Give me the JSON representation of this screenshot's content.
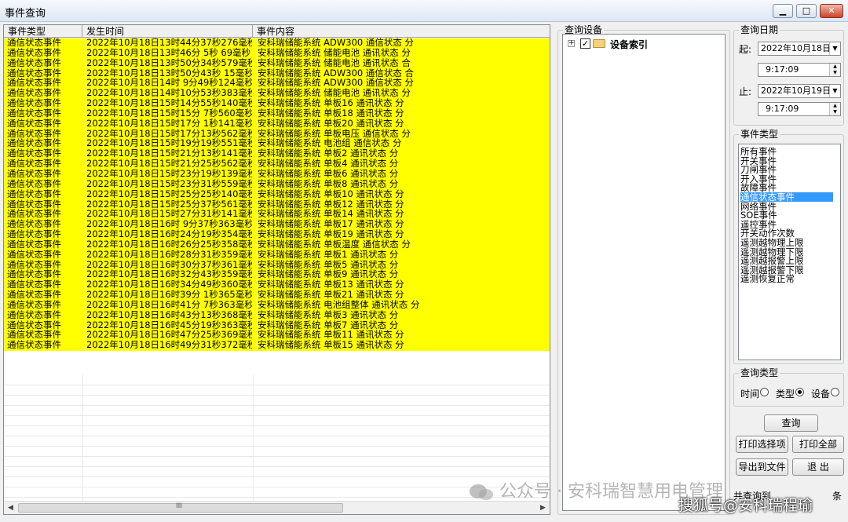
{
  "window": {
    "title": "事件查询",
    "min_glyph": "▁",
    "max_glyph": "□",
    "close_glyph": "✕"
  },
  "grid": {
    "columns": [
      "事件类型",
      "发生时间",
      "事件内容"
    ],
    "rows": [
      [
        "通信状态事件",
        "2022年10月18日13时44分37秒276毫秒",
        "安科瑞储能系统 ADW300 通信状态 分"
      ],
      [
        "通信状态事件",
        "2022年10月18日13时46分 5秒 69毫秒",
        "安科瑞储能系统 储能电池 通讯状态 分"
      ],
      [
        "通信状态事件",
        "2022年10月18日13时50分34秒579毫秒",
        "安科瑞储能系统 储能电池 通讯状态 合"
      ],
      [
        "通信状态事件",
        "2022年10月18日13时50分43秒 15毫秒",
        "安科瑞储能系统 ADW300 通信状态 合"
      ],
      [
        "通信状态事件",
        "2022年10月18日14时 9分49秒124毫秒",
        "安科瑞储能系统 ADW300 通信状态 分"
      ],
      [
        "通信状态事件",
        "2022年10月18日14时10分53秒383毫秒",
        "安科瑞储能系统 储能电池 通讯状态 分"
      ],
      [
        "通信状态事件",
        "2022年10月18日15时14分55秒140毫秒",
        "安科瑞储能系统 单板16 通讯状态 分"
      ],
      [
        "通信状态事件",
        "2022年10月18日15时15分 7秒560毫秒",
        "安科瑞储能系统 单板18 通讯状态 分"
      ],
      [
        "通信状态事件",
        "2022年10月18日15时17分 1秒141毫秒",
        "安科瑞储能系统 单板20 通讯状态 分"
      ],
      [
        "通信状态事件",
        "2022年10月18日15时17分13秒562毫秒",
        "安科瑞储能系统 单板电压 通信状态 分"
      ],
      [
        "通信状态事件",
        "2022年10月18日15时19分19秒551毫秒",
        "安科瑞储能系统 电池组 通信状态 分"
      ],
      [
        "通信状态事件",
        "2022年10月18日15时21分13秒141毫秒",
        "安科瑞储能系统 单板2 通讯状态 分"
      ],
      [
        "通信状态事件",
        "2022年10月18日15时21分25秒562毫秒",
        "安科瑞储能系统 单板4 通讯状态 分"
      ],
      [
        "通信状态事件",
        "2022年10月18日15时23分19秒139毫秒",
        "安科瑞储能系统 单板6 通讯状态 分"
      ],
      [
        "通信状态事件",
        "2022年10月18日15时23分31秒559毫秒",
        "安科瑞储能系统 单板8 通讯状态 分"
      ],
      [
        "通信状态事件",
        "2022年10月18日15时25分25秒140毫秒",
        "安科瑞储能系统 单板10 通讯状态 分"
      ],
      [
        "通信状态事件",
        "2022年10月18日15时25分37秒561毫秒",
        "安科瑞储能系统 单板12 通讯状态 分"
      ],
      [
        "通信状态事件",
        "2022年10月18日15时27分31秒141毫秒",
        "安科瑞储能系统 单板14 通讯状态 分"
      ],
      [
        "通信状态事件",
        "2022年10月18日16时 9分37秒363毫秒",
        "安科瑞储能系统 单板17 通讯状态 分"
      ],
      [
        "通信状态事件",
        "2022年10月18日16时24分19秒354毫秒",
        "安科瑞储能系统 单板19 通讯状态 分"
      ],
      [
        "通信状态事件",
        "2022年10月18日16时26分25秒358毫秒",
        "安科瑞储能系统 单板温度 通信状态 分"
      ],
      [
        "通信状态事件",
        "2022年10月18日16时28分31秒359毫秒",
        "安科瑞储能系统 单板1 通讯状态 分"
      ],
      [
        "通信状态事件",
        "2022年10月18日16时30分37秒361毫秒",
        "安科瑞储能系统 单板5 通讯状态 分"
      ],
      [
        "通信状态事件",
        "2022年10月18日16时32分43秒359毫秒",
        "安科瑞储能系统 单板9 通讯状态 分"
      ],
      [
        "通信状态事件",
        "2022年10月18日16时34分49秒360毫秒",
        "安科瑞储能系统 单板13 通讯状态 分"
      ],
      [
        "通信状态事件",
        "2022年10月18日16时39分 1秒365毫秒",
        "安科瑞储能系统 单板21 通讯状态 分"
      ],
      [
        "通信状态事件",
        "2022年10月18日16时41分 7秒363毫秒",
        "安科瑞储能系统 电池组整体 通讯状态 分"
      ],
      [
        "通信状态事件",
        "2022年10月18日16时43分13秒368毫秒",
        "安科瑞储能系统 单板3 通讯状态 分"
      ],
      [
        "通信状态事件",
        "2022年10月18日16时45分19秒363毫秒",
        "安科瑞储能系统 单板7 通讯状态 分"
      ],
      [
        "通信状态事件",
        "2022年10月18日16时47分25秒369毫秒",
        "安科瑞储能系统 单板11 通讯状态 分"
      ],
      [
        "通信状态事件",
        "2022年10月18日16时49分31秒372毫秒",
        "安科瑞储能系统 单板15 通讯状态 分"
      ]
    ],
    "row_highlight_color": "#ffff00",
    "scroll_grip": "III"
  },
  "device_tree": {
    "group_title": "查询设备",
    "root_label": "设备索引",
    "root_checked": true,
    "expander_glyph": "+",
    "check_glyph": "✓"
  },
  "date_query": {
    "group_title": "查询日期",
    "start_label": "起:",
    "start_date": "2022年10月18日",
    "start_time": "9:17:09",
    "end_label": "止:",
    "end_date": "2022年10月19日",
    "end_time": "9:17:09"
  },
  "event_types": {
    "group_title": "事件类型",
    "items": [
      "所有事件",
      "开关事件",
      "刀闸事件",
      "开入事件",
      "故障事件",
      "通信状态事件",
      "网络事件",
      "SOE事件",
      "遥控事件",
      "开关动作次数",
      "遥测越物理上限",
      "遥测越物理下限",
      "遥测越报警上限",
      "遥测越报警下限",
      "遥测恢复正常"
    ],
    "selected": "通信状态事件"
  },
  "query_type": {
    "group_title": "查询类型",
    "options": [
      "时间",
      "类型",
      "设备"
    ],
    "selected": "类型"
  },
  "buttons": {
    "query": "查询",
    "print_selected": "打印选择项",
    "print_all": "打印全部",
    "export": "导出到文件",
    "exit": "退 出"
  },
  "status": {
    "total_label": "共查询到",
    "count_suffix": "条"
  },
  "watermarks": {
    "wechat": "公众号 · 安科瑞智慧用电管理",
    "sohu": "搜狐号@安科瑞程瑜"
  }
}
